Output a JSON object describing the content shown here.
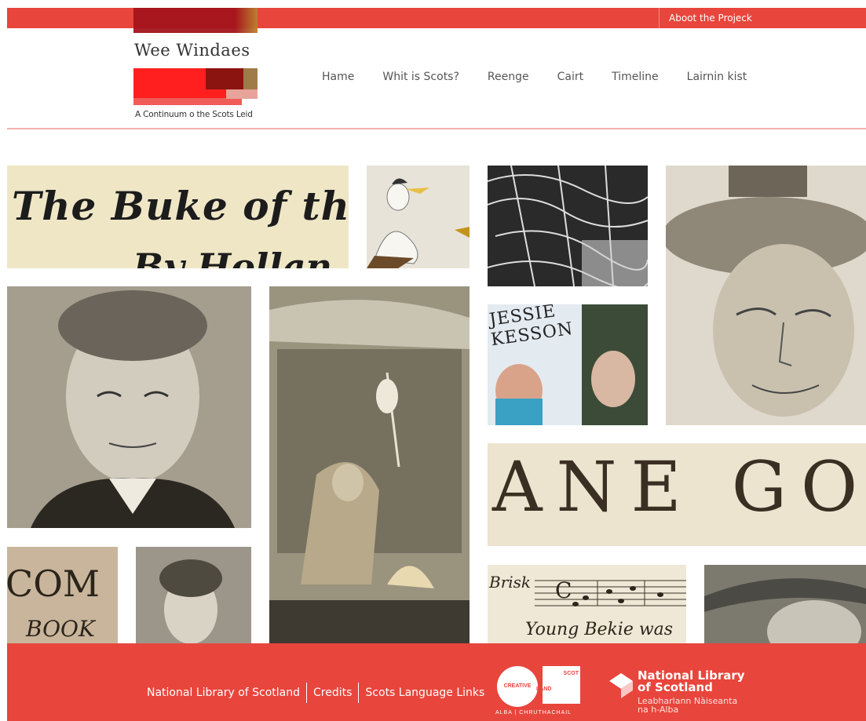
{
  "header": {
    "about_link": "Aboot the Projeck",
    "site_title": "Wee Windaes",
    "tagline": "A Continuum o the Scots Leid"
  },
  "nav": {
    "items": [
      "Hame",
      "Whit is Scots?",
      "Reenge",
      "Cairt",
      "Timeline",
      "Lairnin kist"
    ]
  },
  "gallery": {
    "buke_line1": "The Buke of the L",
    "buke_line2": "By Hollan",
    "ane_go": "ANE GO",
    "com": "COM",
    "book": "BOOK",
    "jessie": "JESSIE",
    "kesson": "KESSON",
    "music_text1": "Brisk",
    "music_text2": "Young Bekie was",
    "music_clef": "C"
  },
  "footer": {
    "links": [
      "National Library of Scotland",
      "Credits",
      "Scots Language Links"
    ],
    "creative_circle": "CREATIVE",
    "creative_sq_top": "SCOT",
    "creative_sq_bottom": "LAND",
    "creative_sub": "ALBA | CHRUTHACHAIL",
    "nls_name_1": "National Library",
    "nls_name_2": "of Scotland",
    "nls_gaelic_1": "Leabharlann Nàiseanta",
    "nls_gaelic_2": "na h-Alba"
  },
  "colors": {
    "brand_red": "#e8453c",
    "divider": "#f2b2ad"
  }
}
